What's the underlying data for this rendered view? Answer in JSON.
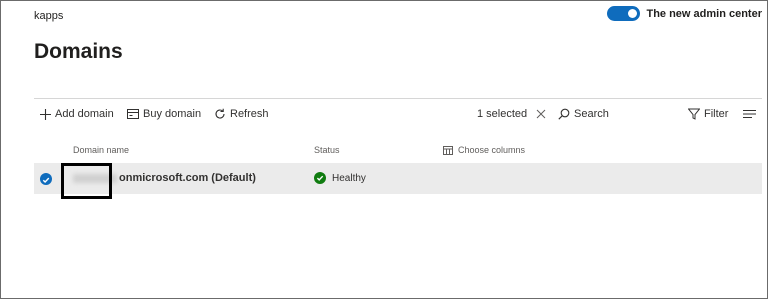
{
  "tenant": "kapps",
  "admin_toggle": {
    "label": "The new admin center",
    "on": true
  },
  "page_title": "Domains",
  "toolbar": {
    "add_label": "Add domain",
    "buy_label": "Buy domain",
    "refresh_label": "Refresh",
    "selected_label": "1 selected",
    "search_label": "Search",
    "filter_label": "Filter"
  },
  "table": {
    "columns": {
      "domain": "Domain name",
      "status": "Status",
      "choose": "Choose columns"
    },
    "rows": [
      {
        "domain": "onmicrosoft.com (Default)",
        "status": "Healthy",
        "selected": true
      }
    ]
  },
  "colors": {
    "accent": "#0f6cbd",
    "healthy": "#107c10",
    "row_selected_bg": "#ebebeb"
  },
  "icons": [
    "add-icon",
    "buy-icon",
    "refresh-icon",
    "close-icon",
    "search-icon",
    "filter-icon",
    "menu-icon",
    "choose-columns-icon",
    "checkmark-icon",
    "healthy-icon"
  ]
}
